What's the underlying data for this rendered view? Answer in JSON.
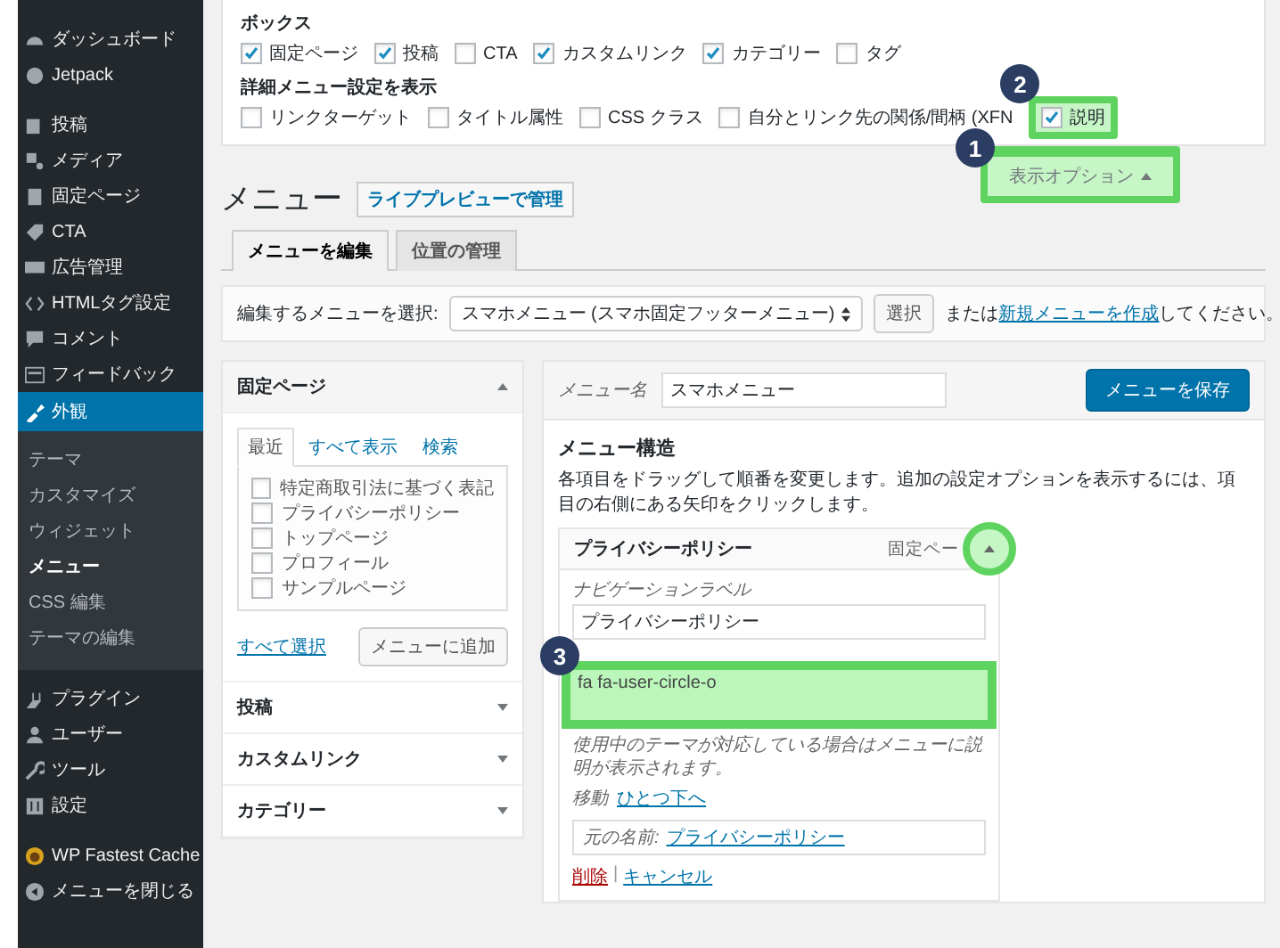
{
  "sidebar": {
    "items": [
      {
        "label": "ダッシュボード",
        "selected": false
      },
      {
        "label": "Jetpack",
        "selected": false
      },
      {
        "label": "投稿",
        "selected": false
      },
      {
        "label": "メディア",
        "selected": false
      },
      {
        "label": "固定ページ",
        "selected": false
      },
      {
        "label": "CTA",
        "selected": false
      },
      {
        "label": "広告管理",
        "selected": false
      },
      {
        "label": "HTMLタグ設定",
        "selected": false
      },
      {
        "label": "コメント",
        "selected": false
      },
      {
        "label": "フィードバック",
        "selected": false
      },
      {
        "label": "外観",
        "selected": true,
        "children": [
          {
            "label": "テーマ",
            "selected": false
          },
          {
            "label": "カスタマイズ",
            "selected": false
          },
          {
            "label": "ウィジェット",
            "selected": false
          },
          {
            "label": "メニュー",
            "selected": true
          },
          {
            "label": "CSS 編集",
            "selected": false
          },
          {
            "label": "テーマの編集",
            "selected": false
          }
        ]
      },
      {
        "label": "プラグイン",
        "selected": false
      },
      {
        "label": "ユーザー",
        "selected": false
      },
      {
        "label": "ツール",
        "selected": false
      },
      {
        "label": "設定",
        "selected": false
      },
      {
        "label": "WP Fastest Cache",
        "selected": false
      },
      {
        "label": "メニューを閉じる",
        "selected": false
      }
    ]
  },
  "screen_options": {
    "sections": [
      {
        "title": "ボックス",
        "options": [
          {
            "label": "固定ページ",
            "checked": true
          },
          {
            "label": "投稿",
            "checked": true
          },
          {
            "label": "CTA",
            "checked": false
          },
          {
            "label": "カスタムリンク",
            "checked": true
          },
          {
            "label": "カテゴリー",
            "checked": true
          },
          {
            "label": "タグ",
            "checked": false
          }
        ]
      },
      {
        "title": "詳細メニュー設定を表示",
        "options": [
          {
            "label": "リンクターゲット",
            "checked": false
          },
          {
            "label": "タイトル属性",
            "checked": false
          },
          {
            "label": "CSS クラス",
            "checked": false
          },
          {
            "label": "自分とリンク先の関係/間柄 (XFN",
            "checked": false
          },
          {
            "label": "説明",
            "checked": true,
            "highlighted": true,
            "marker": "2"
          }
        ]
      }
    ],
    "toggle": {
      "label": "表示オプション",
      "highlighted": true,
      "marker": "1"
    }
  },
  "heading": {
    "title": "メニュー",
    "button": "ライブプレビューで管理"
  },
  "tabs": [
    {
      "label": "メニューを編集",
      "selected": true
    },
    {
      "label": "位置の管理",
      "selected": false
    }
  ],
  "select_bar": {
    "label": "編集するメニューを選択:",
    "value": "スマホメニュー (スマホ固定フッターメニュー)",
    "button": "選択",
    "before": "または",
    "link": "新規メニューを作成",
    "after": "してください。"
  },
  "add_panels": [
    {
      "title": "固定ページ",
      "expanded": true,
      "tabs": [
        {
          "label": "最近",
          "selected": true
        },
        {
          "label": "すべて表示",
          "selected": false
        },
        {
          "label": "検索",
          "selected": false
        }
      ],
      "items": [
        {
          "label": "特定商取引法に基づく表記",
          "checked": false
        },
        {
          "label": "プライバシーポリシー",
          "checked": false
        },
        {
          "label": "トップページ",
          "checked": false
        },
        {
          "label": "プロフィール",
          "checked": false
        },
        {
          "label": "サンプルページ",
          "checked": false
        }
      ],
      "select_all": "すべて選択",
      "add_button": "メニューに追加"
    },
    {
      "title": "投稿",
      "expanded": false
    },
    {
      "title": "カスタムリンク",
      "expanded": false
    },
    {
      "title": "カテゴリー",
      "expanded": false
    }
  ],
  "menu_editor": {
    "name_label": "メニュー名",
    "name_value": "スマホメニュー",
    "save_button": "メニューを保存",
    "structure_title": "メニュー構造",
    "instructions": "各項目をドラッグして順番を変更します。追加の設定オプションを表示するには、項目の右側にある矢印をクリックします。",
    "item": {
      "title": "プライバシーポリシー",
      "type": "固定ペー",
      "expanded": true,
      "toggle_highlighted": true,
      "nav_label": "ナビゲーションラベル",
      "nav_value": "プライバシーポリシー",
      "description_value": "fa fa-user-circle-o",
      "description_highlighted": true,
      "description_marker": "3",
      "help": "使用中のテーマが対応している場合はメニューに説明が表示されます。",
      "move_label": "移動",
      "move_link": "ひとつ下へ",
      "original_label": "元の名前:",
      "original_link": "プライバシーポリシー",
      "delete": "削除",
      "separator": "|",
      "cancel": "キャンセル"
    }
  }
}
